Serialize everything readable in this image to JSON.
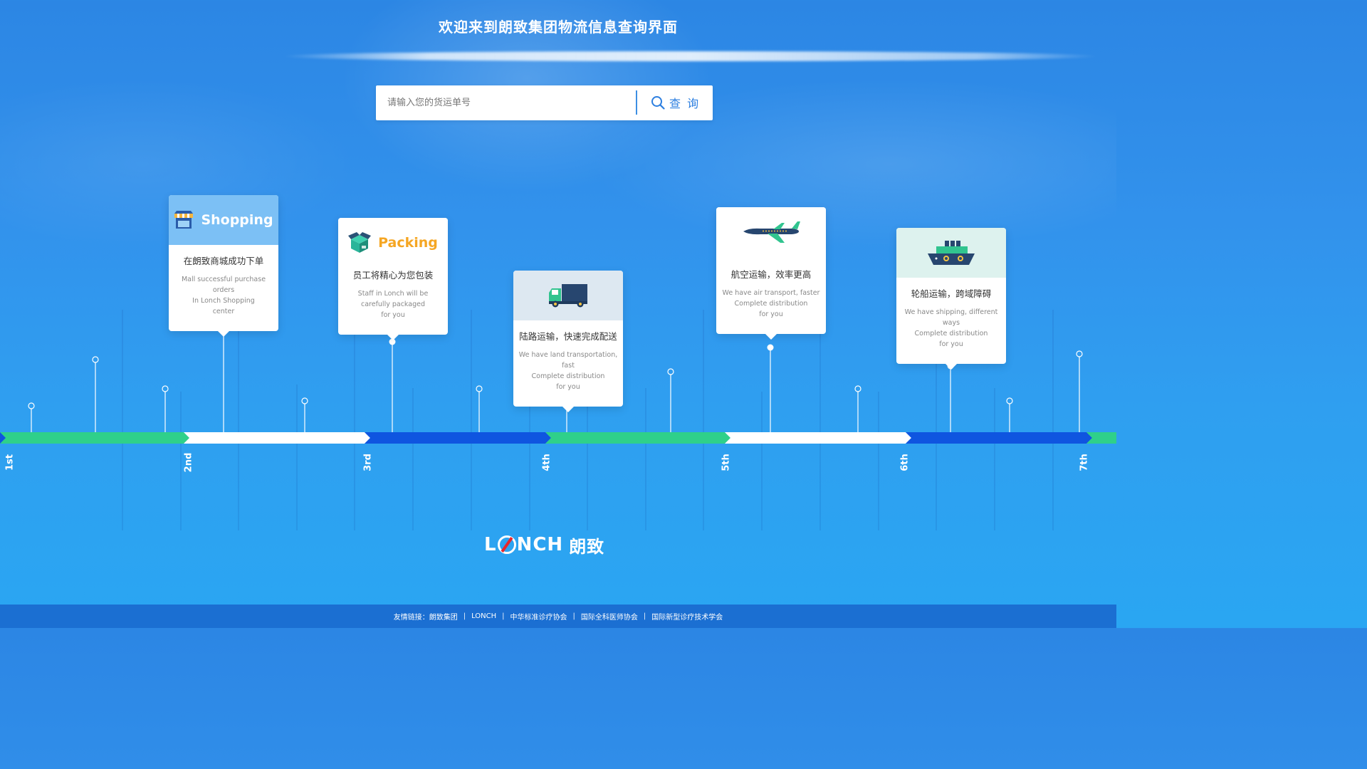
{
  "header": {
    "title": "欢迎来到朗致集团物流信息查询界面"
  },
  "search": {
    "placeholder": "请输入您的货运单号",
    "button_label": "查 询"
  },
  "timeline": {
    "labels": [
      "1st",
      "2nd",
      "3rd",
      "4th",
      "5th",
      "6th",
      "7th"
    ],
    "segment_colors": [
      "#2fd08a",
      "#ffffff",
      "#0f55e0",
      "#2fd08a",
      "#ffffff",
      "#0f55e0",
      "#2fd08a"
    ]
  },
  "cards": [
    {
      "icon": "shop-icon",
      "title_en": "Shopping",
      "title_cn": "在朗致商城成功下单",
      "desc_en": "Mall successful purchase orders\nIn Lonch Shopping\ncenter"
    },
    {
      "icon": "box-icon",
      "title_en": "Packing",
      "title_cn": "员工将精心为您包装",
      "desc_en": "Staff in Lonch  will be\ncarefully packaged\nfor you"
    },
    {
      "icon": "truck-icon",
      "title_cn": "陆路运输，快速完成配送",
      "desc_en": "We have land transportation, fast\nComplete distribution\nfor you"
    },
    {
      "icon": "airplane-icon",
      "title_cn": "航空运输，效率更高",
      "desc_en": "We have air transport, faster\nComplete distribution\nfor you"
    },
    {
      "icon": "ship-icon",
      "title_cn": "轮船运输，跨域障碍",
      "desc_en": "We have shipping, different ways\nComplete distribution\nfor you"
    }
  ],
  "logo": {
    "text_l": "L",
    "text_rest": "NCH",
    "text_cn": "朗致"
  },
  "footer": {
    "prefix": "友情链接：朗致集团",
    "links": [
      "LONCH",
      "中华标准诊疗协会",
      "国际全科医师协会",
      "国际新型诊疗技术学会"
    ]
  },
  "colors": {
    "accent_blue": "#2d7fe0",
    "shopping_orange": "#f5a623",
    "footer_bg": "#1b6fd2"
  }
}
